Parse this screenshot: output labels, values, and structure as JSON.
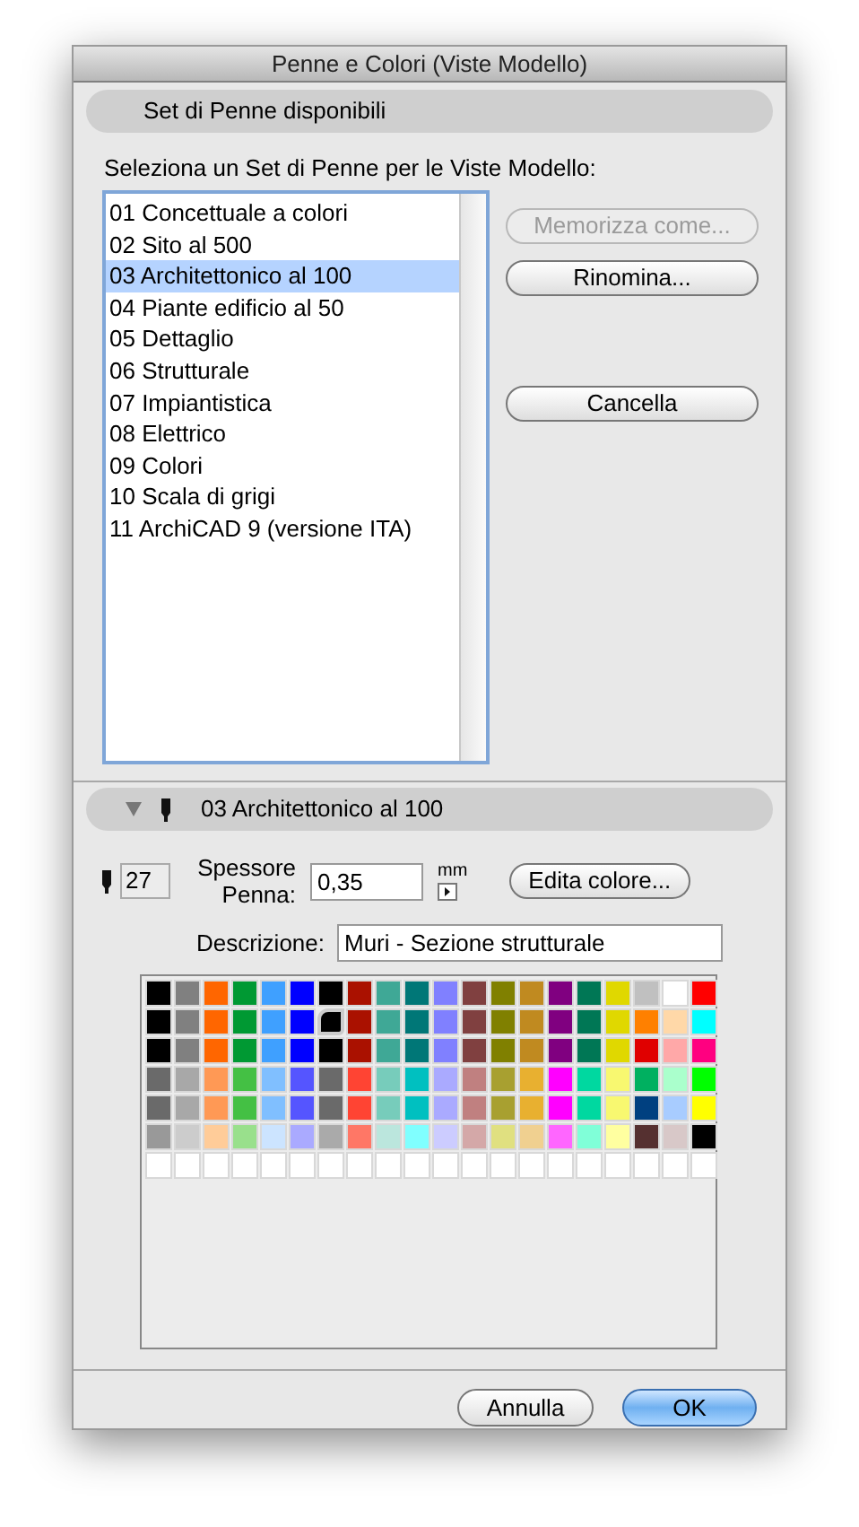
{
  "window": {
    "title": "Penne e Colori (Viste Modello)"
  },
  "pen_sets_section": {
    "title": "Set di Penne disponibili"
  },
  "pen_sets": {
    "label": "Seleziona un Set di Penne per le Viste Modello:",
    "items": [
      {
        "label": "01 Concettuale a colori",
        "selected": false
      },
      {
        "label": "02 Sito al 500",
        "selected": false
      },
      {
        "label": "03 Architettonico al 100",
        "selected": true
      },
      {
        "label": "04 Piante edificio al 50",
        "selected": false
      },
      {
        "label": "05 Dettaglio",
        "selected": false
      },
      {
        "label": "06 Strutturale",
        "selected": false
      },
      {
        "label": "07 Impiantistica",
        "selected": false
      },
      {
        "label": "08 Elettrico",
        "selected": false
      },
      {
        "label": "09 Colori",
        "selected": false
      },
      {
        "label": "10 Scala di grigi",
        "selected": false
      },
      {
        "label": "11 ArchiCAD 9 (versione ITA)",
        "selected": false
      }
    ],
    "buttons": [
      {
        "label": "Memorizza come...",
        "disabled": true
      },
      {
        "label": "Rinomina...",
        "disabled": false
      },
      {
        "label": "Cancella",
        "disabled": false
      }
    ]
  },
  "pen_section": {
    "title": "03 Architettonico al 100",
    "expanded": true
  },
  "pen": {
    "number": "27",
    "thickness_label": "Spessore Penna:",
    "thickness": "0,35",
    "unit": "mm",
    "edit_color_button": "Edita colore...",
    "description_label": "Descrizione:",
    "description": "Muri - Sezione strutturale"
  },
  "palette": [
    [
      {
        "color": "#000000",
        "selected": false
      },
      {
        "color": "#808080",
        "selected": false
      },
      {
        "color": "#ff6600",
        "selected": false
      },
      {
        "color": "#009933",
        "selected": false
      },
      {
        "color": "#3fa0ff",
        "selected": false
      },
      {
        "color": "#0000ff",
        "selected": false
      },
      {
        "color": "#000000",
        "selected": false
      },
      {
        "color": "#aa1100",
        "selected": false
      },
      {
        "color": "#3fa896",
        "selected": false
      },
      {
        "color": "#007777",
        "selected": false
      },
      {
        "color": "#8080ff",
        "selected": false
      },
      {
        "color": "#804040",
        "selected": false
      },
      {
        "color": "#808000",
        "selected": false
      },
      {
        "color": "#c08a20",
        "selected": false
      },
      {
        "color": "#800080",
        "selected": false
      },
      {
        "color": "#007755",
        "selected": false
      },
      {
        "color": "#e0d800",
        "selected": false
      },
      {
        "color": "#c0c0c0",
        "selected": false
      },
      {
        "color": "#ffffff",
        "selected": false
      },
      {
        "color": "#ff0000",
        "selected": false
      }
    ],
    [
      {
        "color": "#000000",
        "selected": false
      },
      {
        "color": "#808080",
        "selected": false
      },
      {
        "color": "#ff6600",
        "selected": false
      },
      {
        "color": "#009933",
        "selected": false
      },
      {
        "color": "#3fa0ff",
        "selected": false
      },
      {
        "color": "#0000ff",
        "selected": false
      },
      {
        "color": "#000000",
        "selected": true
      },
      {
        "color": "#aa1100",
        "selected": false
      },
      {
        "color": "#3fa896",
        "selected": false
      },
      {
        "color": "#007777",
        "selected": false
      },
      {
        "color": "#8080ff",
        "selected": false
      },
      {
        "color": "#804040",
        "selected": false
      },
      {
        "color": "#808000",
        "selected": false
      },
      {
        "color": "#c08a20",
        "selected": false
      },
      {
        "color": "#800080",
        "selected": false
      },
      {
        "color": "#007755",
        "selected": false
      },
      {
        "color": "#e0d800",
        "selected": false
      },
      {
        "color": "#ff8000",
        "selected": false
      },
      {
        "color": "#ffd8a8",
        "selected": false
      },
      {
        "color": "#00ffff",
        "selected": false
      }
    ],
    [
      {
        "color": "#000000",
        "selected": false
      },
      {
        "color": "#808080",
        "selected": false
      },
      {
        "color": "#ff6600",
        "selected": false
      },
      {
        "color": "#009933",
        "selected": false
      },
      {
        "color": "#3fa0ff",
        "selected": false
      },
      {
        "color": "#0000ff",
        "selected": false
      },
      {
        "color": "#000000",
        "selected": false
      },
      {
        "color": "#aa1100",
        "selected": false
      },
      {
        "color": "#3fa896",
        "selected": false
      },
      {
        "color": "#007777",
        "selected": false
      },
      {
        "color": "#8080ff",
        "selected": false
      },
      {
        "color": "#804040",
        "selected": false
      },
      {
        "color": "#808000",
        "selected": false
      },
      {
        "color": "#c08a20",
        "selected": false
      },
      {
        "color": "#800080",
        "selected": false
      },
      {
        "color": "#007755",
        "selected": false
      },
      {
        "color": "#e0d800",
        "selected": false
      },
      {
        "color": "#e00000",
        "selected": false
      },
      {
        "color": "#ffa8a8",
        "selected": false
      },
      {
        "color": "#ff0080",
        "selected": false
      }
    ],
    [
      {
        "color": "#6a6a6a",
        "selected": false
      },
      {
        "color": "#a8a8a8",
        "selected": false
      },
      {
        "color": "#ff9955",
        "selected": false
      },
      {
        "color": "#44c044",
        "selected": false
      },
      {
        "color": "#80bfff",
        "selected": false
      },
      {
        "color": "#5555ff",
        "selected": false
      },
      {
        "color": "#6a6a6a",
        "selected": false
      },
      {
        "color": "#ff4433",
        "selected": false
      },
      {
        "color": "#77ccbb",
        "selected": false
      },
      {
        "color": "#00c0c0",
        "selected": false
      },
      {
        "color": "#aaaaff",
        "selected": false
      },
      {
        "color": "#c08080",
        "selected": false
      },
      {
        "color": "#a8a030",
        "selected": false
      },
      {
        "color": "#e8b030",
        "selected": false
      },
      {
        "color": "#ff00ff",
        "selected": false
      },
      {
        "color": "#00d8a0",
        "selected": false
      },
      {
        "color": "#f8f870",
        "selected": false
      },
      {
        "color": "#00b060",
        "selected": false
      },
      {
        "color": "#aaffcc",
        "selected": false
      },
      {
        "color": "#00ff00",
        "selected": false
      }
    ],
    [
      {
        "color": "#6a6a6a",
        "selected": false
      },
      {
        "color": "#a8a8a8",
        "selected": false
      },
      {
        "color": "#ff9955",
        "selected": false
      },
      {
        "color": "#44c044",
        "selected": false
      },
      {
        "color": "#80bfff",
        "selected": false
      },
      {
        "color": "#5555ff",
        "selected": false
      },
      {
        "color": "#6a6a6a",
        "selected": false
      },
      {
        "color": "#ff4433",
        "selected": false
      },
      {
        "color": "#77ccbb",
        "selected": false
      },
      {
        "color": "#00c0c0",
        "selected": false
      },
      {
        "color": "#aaaaff",
        "selected": false
      },
      {
        "color": "#c08080",
        "selected": false
      },
      {
        "color": "#a8a030",
        "selected": false
      },
      {
        "color": "#e8b030",
        "selected": false
      },
      {
        "color": "#ff00ff",
        "selected": false
      },
      {
        "color": "#00d8a0",
        "selected": false
      },
      {
        "color": "#f8f870",
        "selected": false
      },
      {
        "color": "#004080",
        "selected": false
      },
      {
        "color": "#a8ccff",
        "selected": false
      },
      {
        "color": "#ffff00",
        "selected": false
      }
    ],
    [
      {
        "color": "#999999",
        "selected": false
      },
      {
        "color": "#cccccc",
        "selected": false
      },
      {
        "color": "#ffcc99",
        "selected": false
      },
      {
        "color": "#99e08c",
        "selected": false
      },
      {
        "color": "#cce4ff",
        "selected": false
      },
      {
        "color": "#aaaaff",
        "selected": false
      },
      {
        "color": "#aaaaaa",
        "selected": false
      },
      {
        "color": "#ff7766",
        "selected": false
      },
      {
        "color": "#bbe6dd",
        "selected": false
      },
      {
        "color": "#80ffff",
        "selected": false
      },
      {
        "color": "#ccccff",
        "selected": false
      },
      {
        "color": "#d4a8a8",
        "selected": false
      },
      {
        "color": "#e0e080",
        "selected": false
      },
      {
        "color": "#f0d090",
        "selected": false
      },
      {
        "color": "#ff66ff",
        "selected": false
      },
      {
        "color": "#80ffd8",
        "selected": false
      },
      {
        "color": "#ffffa0",
        "selected": false
      },
      {
        "color": "#553030",
        "selected": false
      },
      {
        "color": "#d8c8c8",
        "selected": false
      },
      {
        "color": "#000000",
        "selected": false
      }
    ],
    [
      {
        "color": "#ffffff",
        "selected": false
      },
      {
        "color": "#ffffff",
        "selected": false
      },
      {
        "color": "#ffffff",
        "selected": false
      },
      {
        "color": "#ffffff",
        "selected": false
      },
      {
        "color": "#ffffff",
        "selected": false
      },
      {
        "color": "#ffffff",
        "selected": false
      },
      {
        "color": "#ffffff",
        "selected": false
      },
      {
        "color": "#ffffff",
        "selected": false
      },
      {
        "color": "#ffffff",
        "selected": false
      },
      {
        "color": "#ffffff",
        "selected": false
      },
      {
        "color": "#ffffff",
        "selected": false
      },
      {
        "color": "#ffffff",
        "selected": false
      },
      {
        "color": "#ffffff",
        "selected": false
      },
      {
        "color": "#ffffff",
        "selected": false
      },
      {
        "color": "#ffffff",
        "selected": false
      },
      {
        "color": "#ffffff",
        "selected": false
      },
      {
        "color": "#ffffff",
        "selected": false
      },
      {
        "color": "#ffffff",
        "selected": false
      },
      {
        "color": "#ffffff",
        "selected": false
      },
      {
        "color": "#ffffff",
        "selected": false
      }
    ]
  ],
  "footer_buttons": [
    {
      "label": "Annulla",
      "kind": "secondary"
    },
    {
      "label": "OK",
      "kind": "default"
    }
  ]
}
